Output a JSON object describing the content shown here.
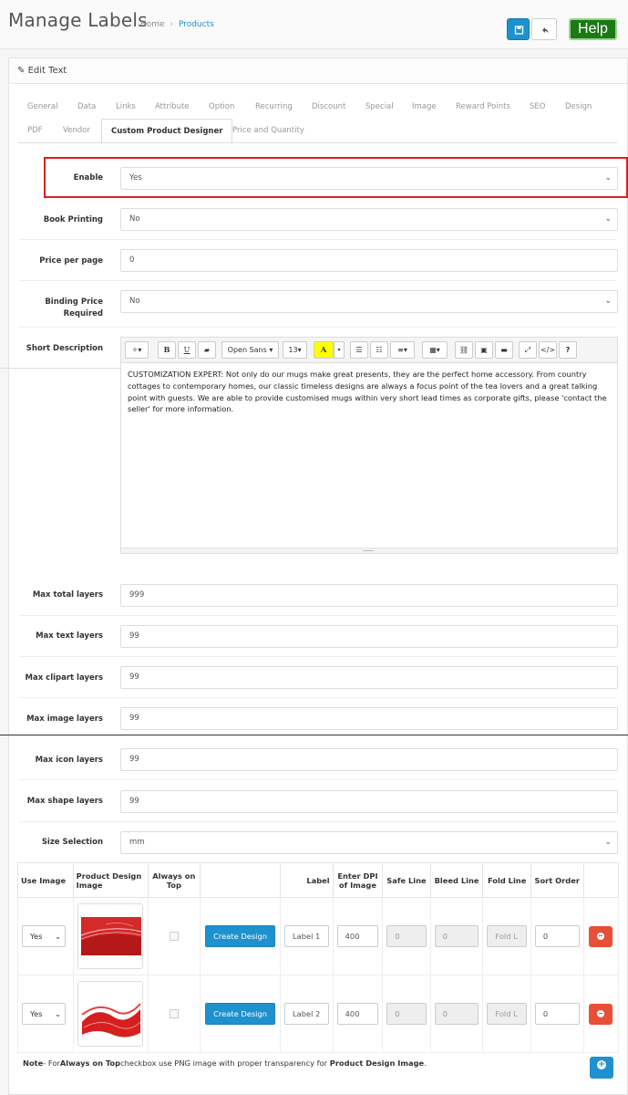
{
  "header": {
    "title": "Manage Labels",
    "breadcrumb": [
      "Home",
      "Products"
    ],
    "help_label": "Help"
  },
  "panel": {
    "title": "Edit Text"
  },
  "tabs_row1": [
    "General",
    "Data",
    "Links",
    "Attribute",
    "Option",
    "Recurring",
    "Discount",
    "Special",
    "Image",
    "Reward Points",
    "SEO",
    "Design"
  ],
  "tabs_row2": [
    "PDF",
    "Vendor",
    "Custom Product Designer",
    "Price and Quantity"
  ],
  "form": {
    "enable": {
      "label": "Enable",
      "value": "Yes"
    },
    "book_printing": {
      "label": "Book Printing",
      "value": "No"
    },
    "price_per_page": {
      "label": "Price per page",
      "value": "0"
    },
    "binding_price": {
      "label": "Binding Price Required",
      "value": "No"
    },
    "short_description": {
      "label": "Short Description",
      "font": "Open Sans",
      "size": "13",
      "text": "CUSTOMIZATION EXPERT: Not only do our mugs make great presents, they are the perfect home accessory. From country cottages to contemporary homes, our classic timeless designs are always a focus point of the tea lovers and a great talking point with guests. We are able to provide customised mugs within very short lead times as corporate gifts, please 'contact the seller' for more information."
    },
    "max_total_layers": {
      "label": "Max total layers",
      "value": "999"
    },
    "max_text_layers": {
      "label": "Max text layers",
      "value": "99"
    },
    "max_clipart_layers": {
      "label": "Max clipart layers",
      "value": "99"
    },
    "max_image_layers": {
      "label": "Max image layers",
      "value": "99"
    },
    "max_icon_layers": {
      "label": "Max icon layers",
      "value": "99"
    },
    "max_shape_layers": {
      "label": "Max shape layers",
      "value": "99"
    },
    "size_selection": {
      "label": "Size Selection",
      "value": "mm"
    }
  },
  "table": {
    "headers": [
      "Use Image",
      "Product Design Image",
      "Always on Top",
      "",
      "Label",
      "Enter DPI of Image",
      "Safe Line",
      "Bleed Line",
      "Fold Line",
      "Sort Order",
      ""
    ],
    "create_label": "Create Design",
    "rows": [
      {
        "use_image": "Yes",
        "label": "Label 1",
        "dpi": "400",
        "safe": "0",
        "bleed": "0",
        "fold": "Fold L",
        "sort": "0"
      },
      {
        "use_image": "Yes",
        "label": "Label 2",
        "dpi": "400",
        "safe": "0",
        "bleed": "0",
        "fold": "Fold L",
        "sort": "0"
      }
    ]
  },
  "note": {
    "prefix": "Note",
    "text1": "- For",
    "bold1": "Always on Top",
    "text2": "checkbox use PNG image with proper transparency for ",
    "bold2": "Product Design Image",
    "text3": "."
  },
  "colors": {
    "primary": "#1e91cf",
    "help": "#1b7a13",
    "danger": "#e94e36",
    "highlight": "#e21d1d"
  }
}
